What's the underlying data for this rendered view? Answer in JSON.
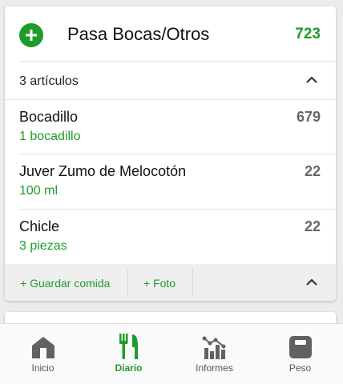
{
  "colors": {
    "accent": "#1e9c2a",
    "text": "#111111",
    "muted": "#666666",
    "icon_gray": "#616161"
  },
  "meal": {
    "add_icon": "plus-circle-icon",
    "title": "Pasa Bocas/Otros",
    "total_calories": "723",
    "summary": "3 artículos",
    "collapse_icon": "chevron-up-icon"
  },
  "items": [
    {
      "name": "Bocadillo",
      "quantity": "1  bocadillo",
      "calories": "679"
    },
    {
      "name": "Juver Zumo de Melocotón",
      "quantity": "100  ml",
      "calories": "22"
    },
    {
      "name": "Chicle",
      "quantity": "3  piezas",
      "calories": "22"
    }
  ],
  "footer": {
    "save_meal": "+ Guardar comida",
    "photo": "+ Foto",
    "collapse_icon": "chevron-up-icon"
  },
  "nav": [
    {
      "label": "Inicio",
      "icon": "home-icon",
      "active": false
    },
    {
      "label": "Diario",
      "icon": "fork-knife-icon",
      "active": true
    },
    {
      "label": "Informes",
      "icon": "chart-icon",
      "active": false
    },
    {
      "label": "Peso",
      "icon": "scale-icon",
      "active": false
    }
  ]
}
